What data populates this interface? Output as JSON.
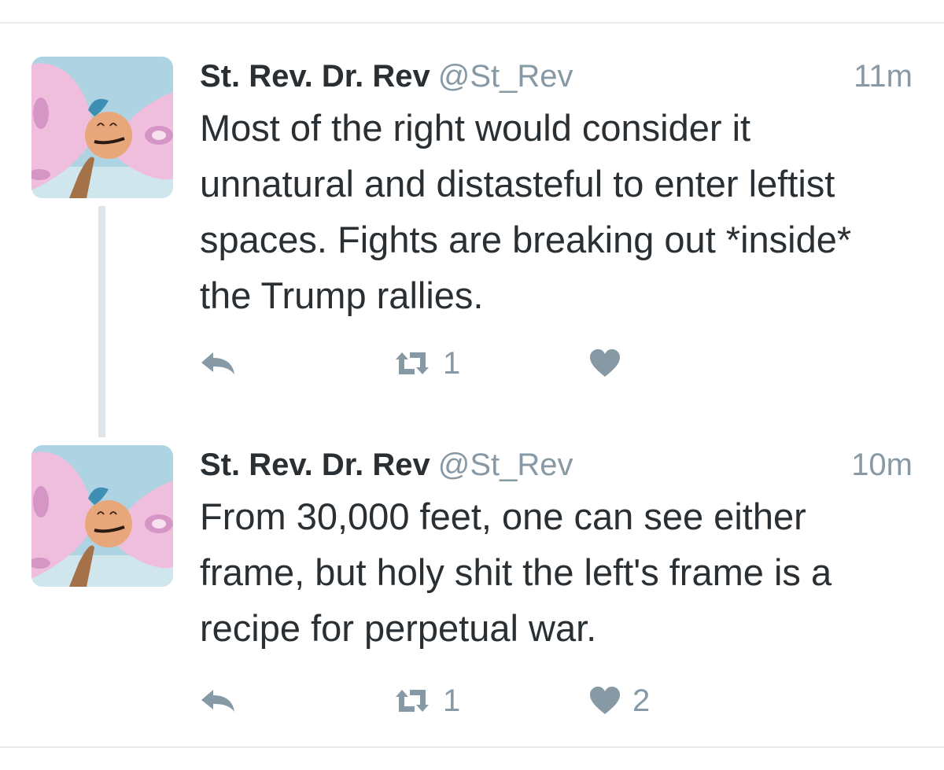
{
  "tweets": [
    {
      "display_name": "St. Rev. Dr. Rev",
      "handle": "@St_Rev",
      "timestamp": "11m",
      "text": "Most of the right would consider it unnatural and distasteful to enter leftist spaces. Fights are breaking out *inside* the Trump rallies.",
      "retweet_count": "1",
      "like_count": ""
    },
    {
      "display_name": "St. Rev. Dr. Rev",
      "handle": "@St_Rev",
      "timestamp": "10m",
      "text": "From 30,000 feet, one can see either frame, but holy shit the left's frame is a recipe for perpetual war.",
      "retweet_count": "1",
      "like_count": "2"
    }
  ],
  "colors": {
    "text": "#292f33",
    "muted": "#8899a6",
    "divider": "#e6ecf0",
    "thread_line": "#dfe6ea"
  },
  "icons": {
    "reply": "reply-icon",
    "retweet": "retweet-icon",
    "like": "heart-icon"
  }
}
